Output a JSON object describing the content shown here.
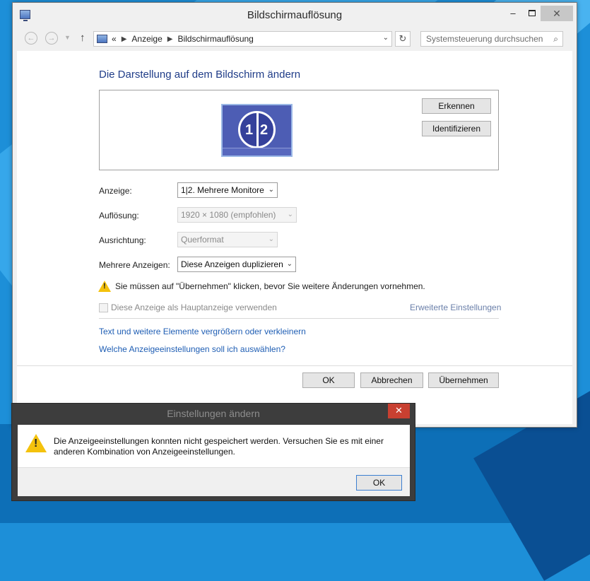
{
  "window": {
    "title": "Bildschirmauflösung",
    "min_glyph": "–",
    "close_glyph": "✕"
  },
  "nav": {
    "breadcrumb_prefix": "«",
    "breadcrumb": [
      "Anzeige",
      "Bildschirmauflösung"
    ],
    "search_placeholder": "Systemsteuerung durchsuchen"
  },
  "main": {
    "heading": "Die Darstellung auf dem Bildschirm ändern",
    "detect_label": "Erkennen",
    "identify_label": "Identifizieren",
    "monitor_numbers": [
      "1",
      "2"
    ],
    "fields": {
      "display_label": "Anzeige:",
      "display_value": "1|2. Mehrere Monitore",
      "resolution_label": "Auflösung:",
      "resolution_value": "1920 × 1080 (empfohlen)",
      "orientation_label": "Ausrichtung:",
      "orientation_value": "Querformat",
      "multiple_label": "Mehrere Anzeigen:",
      "multiple_value": "Diese Anzeigen duplizieren"
    },
    "warning": "Sie müssen auf \"Übernehmen\" klicken, bevor Sie weitere Änderungen vornehmen.",
    "primary_checkbox_label": "Diese Anzeige als Hauptanzeige verwenden",
    "advanced_link": "Erweiterte Einstellungen",
    "link1": "Text und weitere Elemente vergrößern oder verkleinern",
    "link2": "Welche Anzeigeeinstellungen soll ich auswählen?",
    "ok_label": "OK",
    "cancel_label": "Abbrechen",
    "apply_label": "Übernehmen"
  },
  "dialog": {
    "title": "Einstellungen ändern",
    "message_line1": "Die Anzeigeeinstellungen konnten nicht gespeichert werden. Versuchen Sie es mit einer",
    "message_line2": "anderen Kombination von Anzeigeeinstellungen.",
    "ok_label": "OK",
    "close_glyph": "✕"
  },
  "colors": {
    "heading": "#1f3c88",
    "link": "#1f5eb4",
    "warning": "#f4c20d",
    "dialog_close": "#c84031"
  }
}
